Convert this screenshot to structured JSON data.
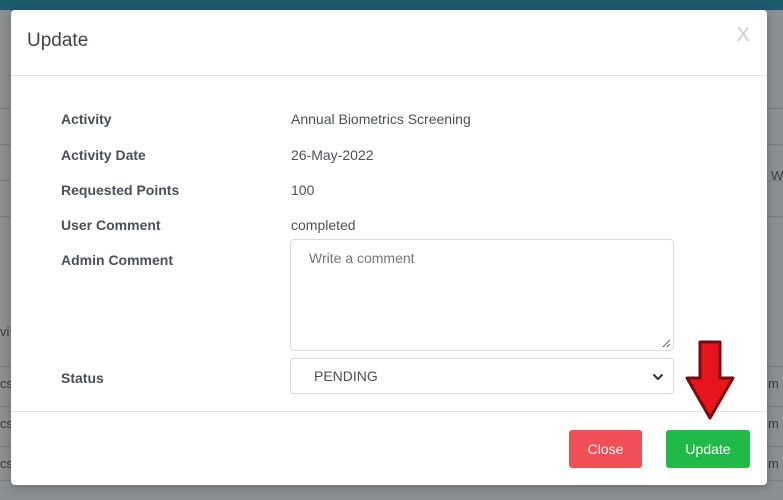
{
  "background": {
    "fragments": [
      "vi",
      "cs",
      "cs",
      "cs",
      "W",
      "m",
      "m",
      "m"
    ]
  },
  "modal": {
    "title": "Update",
    "close_symbol": "X",
    "fields": [
      {
        "label": "Activity",
        "value": "Annual Biometrics Screening"
      },
      {
        "label": "Activity Date",
        "value": "26-May-2022"
      },
      {
        "label": "Requested Points",
        "value": "100"
      },
      {
        "label": "User Comment",
        "value": "completed"
      }
    ],
    "admin_comment": {
      "label": "Admin Comment",
      "value": "",
      "placeholder": "Write a comment"
    },
    "status": {
      "label": "Status",
      "selected": "PENDING"
    },
    "footer": {
      "close_label": "Close",
      "update_label": "Update"
    }
  },
  "colors": {
    "close_button": "#ef4f55",
    "update_button": "#21b94a",
    "arrow": "#e8141b",
    "header_bar": "#1c5a6e"
  },
  "icons": {
    "close": "close-icon",
    "dropdown": "chevron-down-icon",
    "annotation": "arrow-down-icon"
  }
}
